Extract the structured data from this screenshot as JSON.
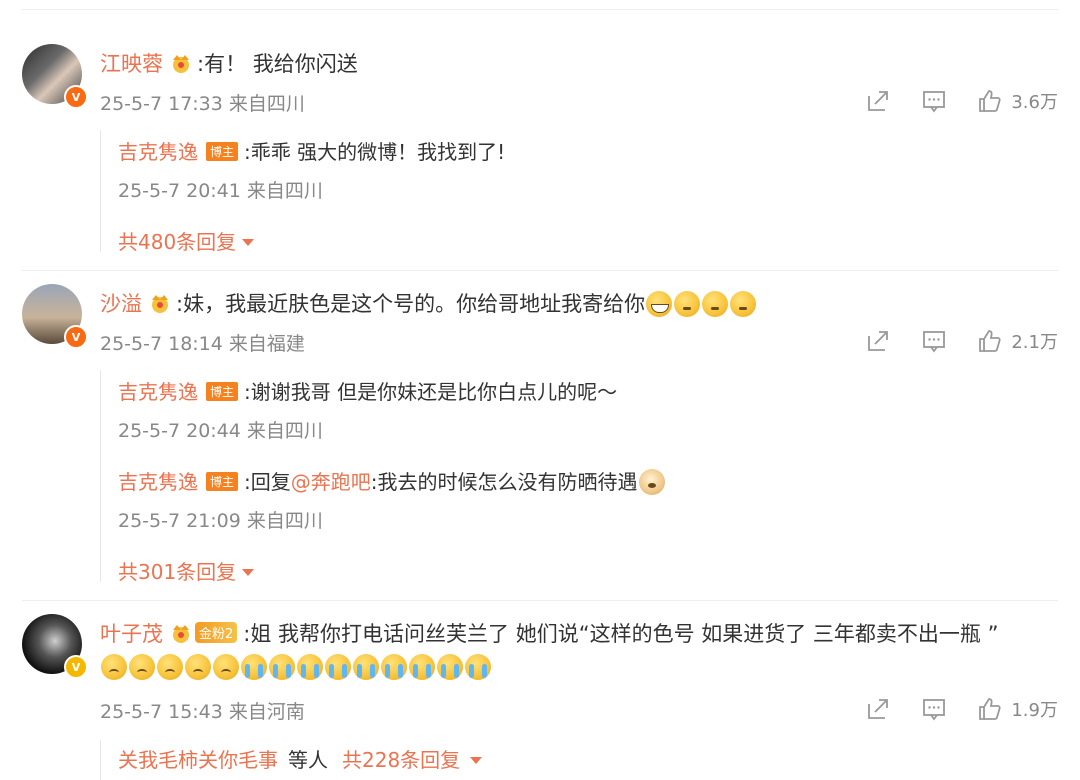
{
  "comments": [
    {
      "username": "江映蓉",
      "text": ":有！ 我给你闪送",
      "timestamp": "25-5-7 17:33 来自四川",
      "likes": "3.6万",
      "replies": [
        {
          "username": "吉克隽逸",
          "badge": "博主",
          "text": ":乖乖 强大的微博！我找到了!",
          "timestamp": "25-5-7 20:41 来自四川"
        }
      ],
      "more_replies": "共480条回复"
    },
    {
      "username": "沙溢",
      "text": ":妹，我最近肤色是这个号的。你给哥地址我寄给你",
      "timestamp": "25-5-7 18:14 来自福建",
      "likes": "2.1万",
      "replies": [
        {
          "username": "吉克隽逸",
          "badge": "博主",
          "text": ":谢谢我哥 但是你妹还是比你白点儿的呢～",
          "timestamp": "25-5-7 20:44 来自四川"
        },
        {
          "username": "吉克隽逸",
          "badge": "博主",
          "text_prefix": ":回复",
          "mention": "@奔跑吧",
          "text": ":我去的时候怎么没有防晒待遇",
          "timestamp": "25-5-7 21:09 来自四川"
        }
      ],
      "more_replies": "共301条回复"
    },
    {
      "username": "叶子茂",
      "fan_badge": "金粉2",
      "text": ":姐 我帮你打电话问丝芙兰了 她们说“这样的色号 如果进货了 三年都卖不出一瓶 ”",
      "timestamp": "25-5-7 15:43 来自河南",
      "likes": "1.9万",
      "reply_preview": {
        "name": "关我毛柿关你毛事",
        "text": "等人",
        "more": "共228条回复"
      }
    }
  ],
  "icons": {
    "share": "share-icon",
    "comment": "comment-icon",
    "like": "thumbs-up-icon",
    "crown": "crown-icon",
    "verified": "verified-badge-icon"
  },
  "colors": {
    "username": "#eb7350",
    "meta": "#888888",
    "badge": "#f5821f"
  }
}
